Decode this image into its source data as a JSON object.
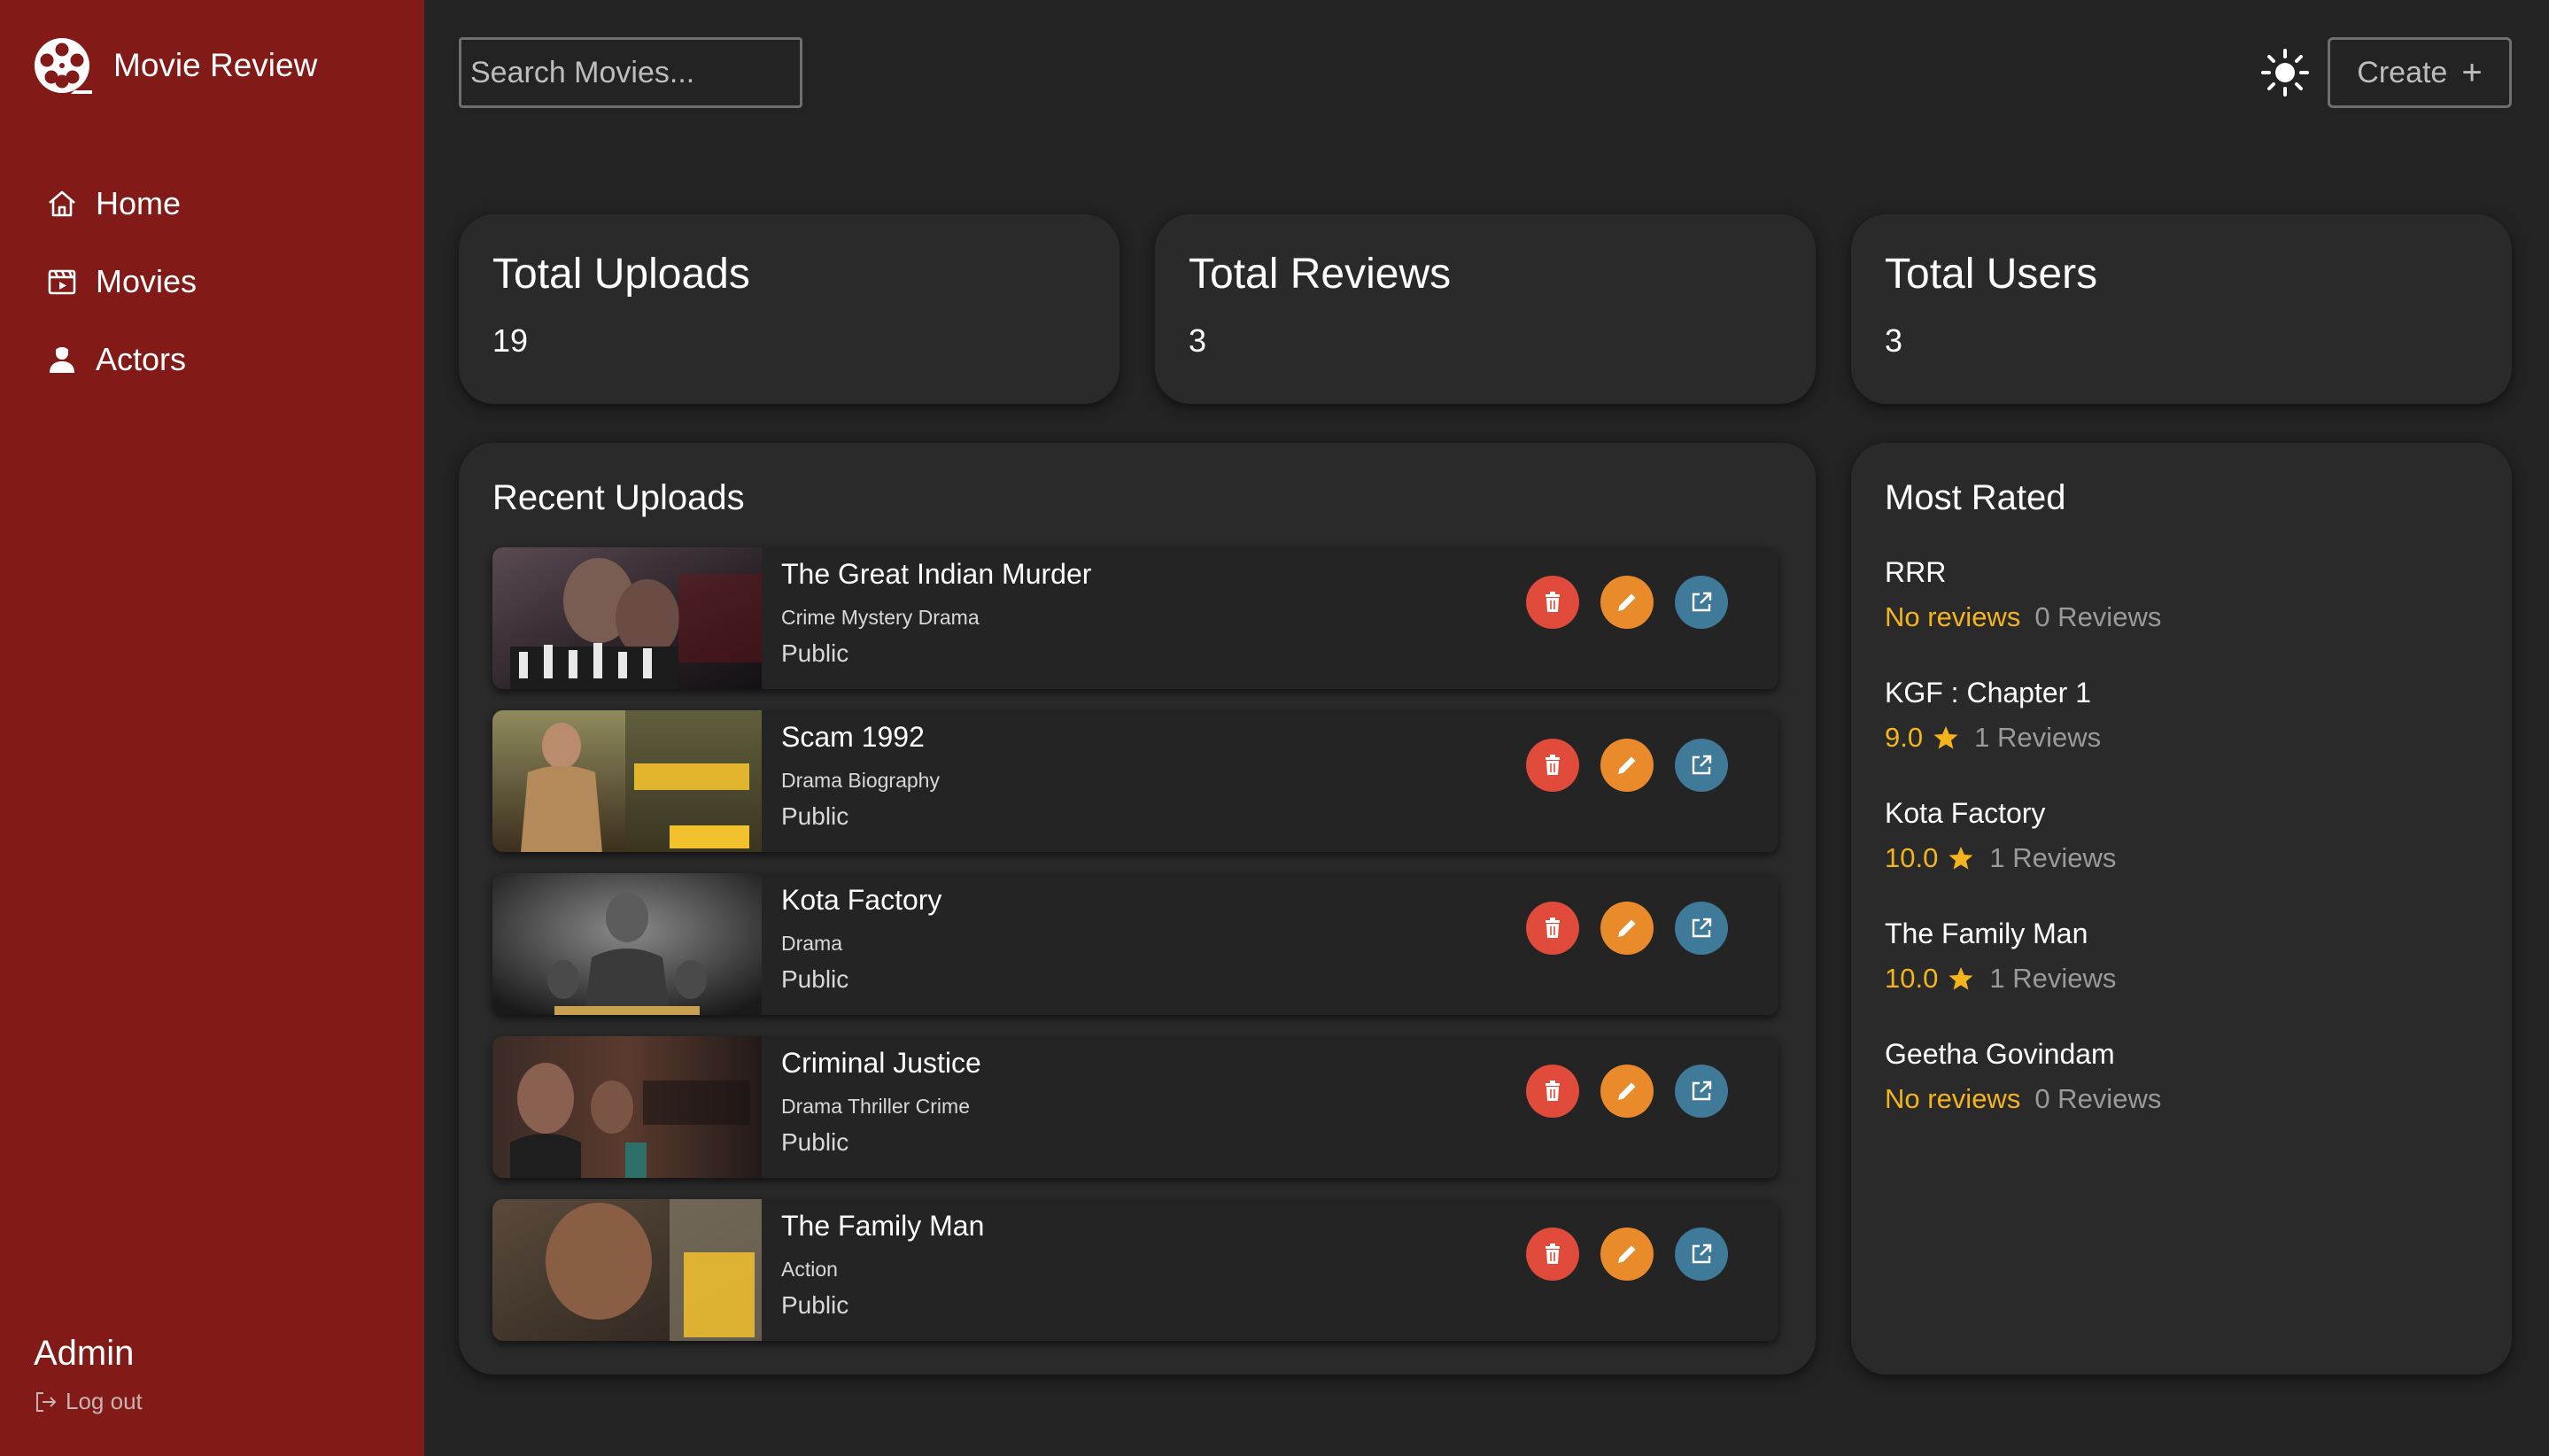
{
  "app": {
    "title": "Movie Review"
  },
  "sidebar": {
    "items": [
      {
        "label": "Home",
        "icon": "home-icon"
      },
      {
        "label": "Movies",
        "icon": "clapperboard-icon"
      },
      {
        "label": "Actors",
        "icon": "user-icon"
      }
    ],
    "user": {
      "name": "Admin",
      "logout_label": "Log out"
    }
  },
  "topbar": {
    "search_placeholder": "Search Movies...",
    "create_label": "Create",
    "create_icon": "+",
    "theme_icon": "sun-icon"
  },
  "stats": [
    {
      "title": "Total Uploads",
      "value": "19"
    },
    {
      "title": "Total Reviews",
      "value": "3"
    },
    {
      "title": "Total Users",
      "value": "3"
    }
  ],
  "recent_uploads": {
    "title": "Recent Uploads",
    "items": [
      {
        "title": "The Great Indian Murder",
        "genres": "Crime Mystery Drama",
        "visibility": "Public"
      },
      {
        "title": "Scam 1992",
        "genres": "Drama Biography",
        "visibility": "Public"
      },
      {
        "title": "Kota Factory",
        "genres": "Drama",
        "visibility": "Public"
      },
      {
        "title": "Criminal Justice",
        "genres": "Drama Thriller Crime",
        "visibility": "Public"
      },
      {
        "title": "The Family Man",
        "genres": "Action",
        "visibility": "Public"
      }
    ]
  },
  "most_rated": {
    "title": "Most Rated",
    "items": [
      {
        "name": "RRR",
        "score": "No reviews",
        "count": "0 Reviews",
        "star": false
      },
      {
        "name": "KGF : Chapter 1",
        "score": "9.0",
        "count": "1 Reviews",
        "star": true
      },
      {
        "name": "Kota Factory",
        "score": "10.0",
        "count": "1 Reviews",
        "star": true
      },
      {
        "name": "The Family Man",
        "score": "10.0",
        "count": "1 Reviews",
        "star": true
      },
      {
        "name": "Geetha Govindam",
        "score": "No reviews",
        "count": "0 Reviews",
        "star": false
      }
    ]
  },
  "colors": {
    "sidebar": "#821a17",
    "background": "#232323",
    "card": "#2a2a2a",
    "delete": "#e04b3c",
    "edit": "#e98a2b",
    "open": "#3f7a98",
    "rating": "#f4b51c"
  }
}
